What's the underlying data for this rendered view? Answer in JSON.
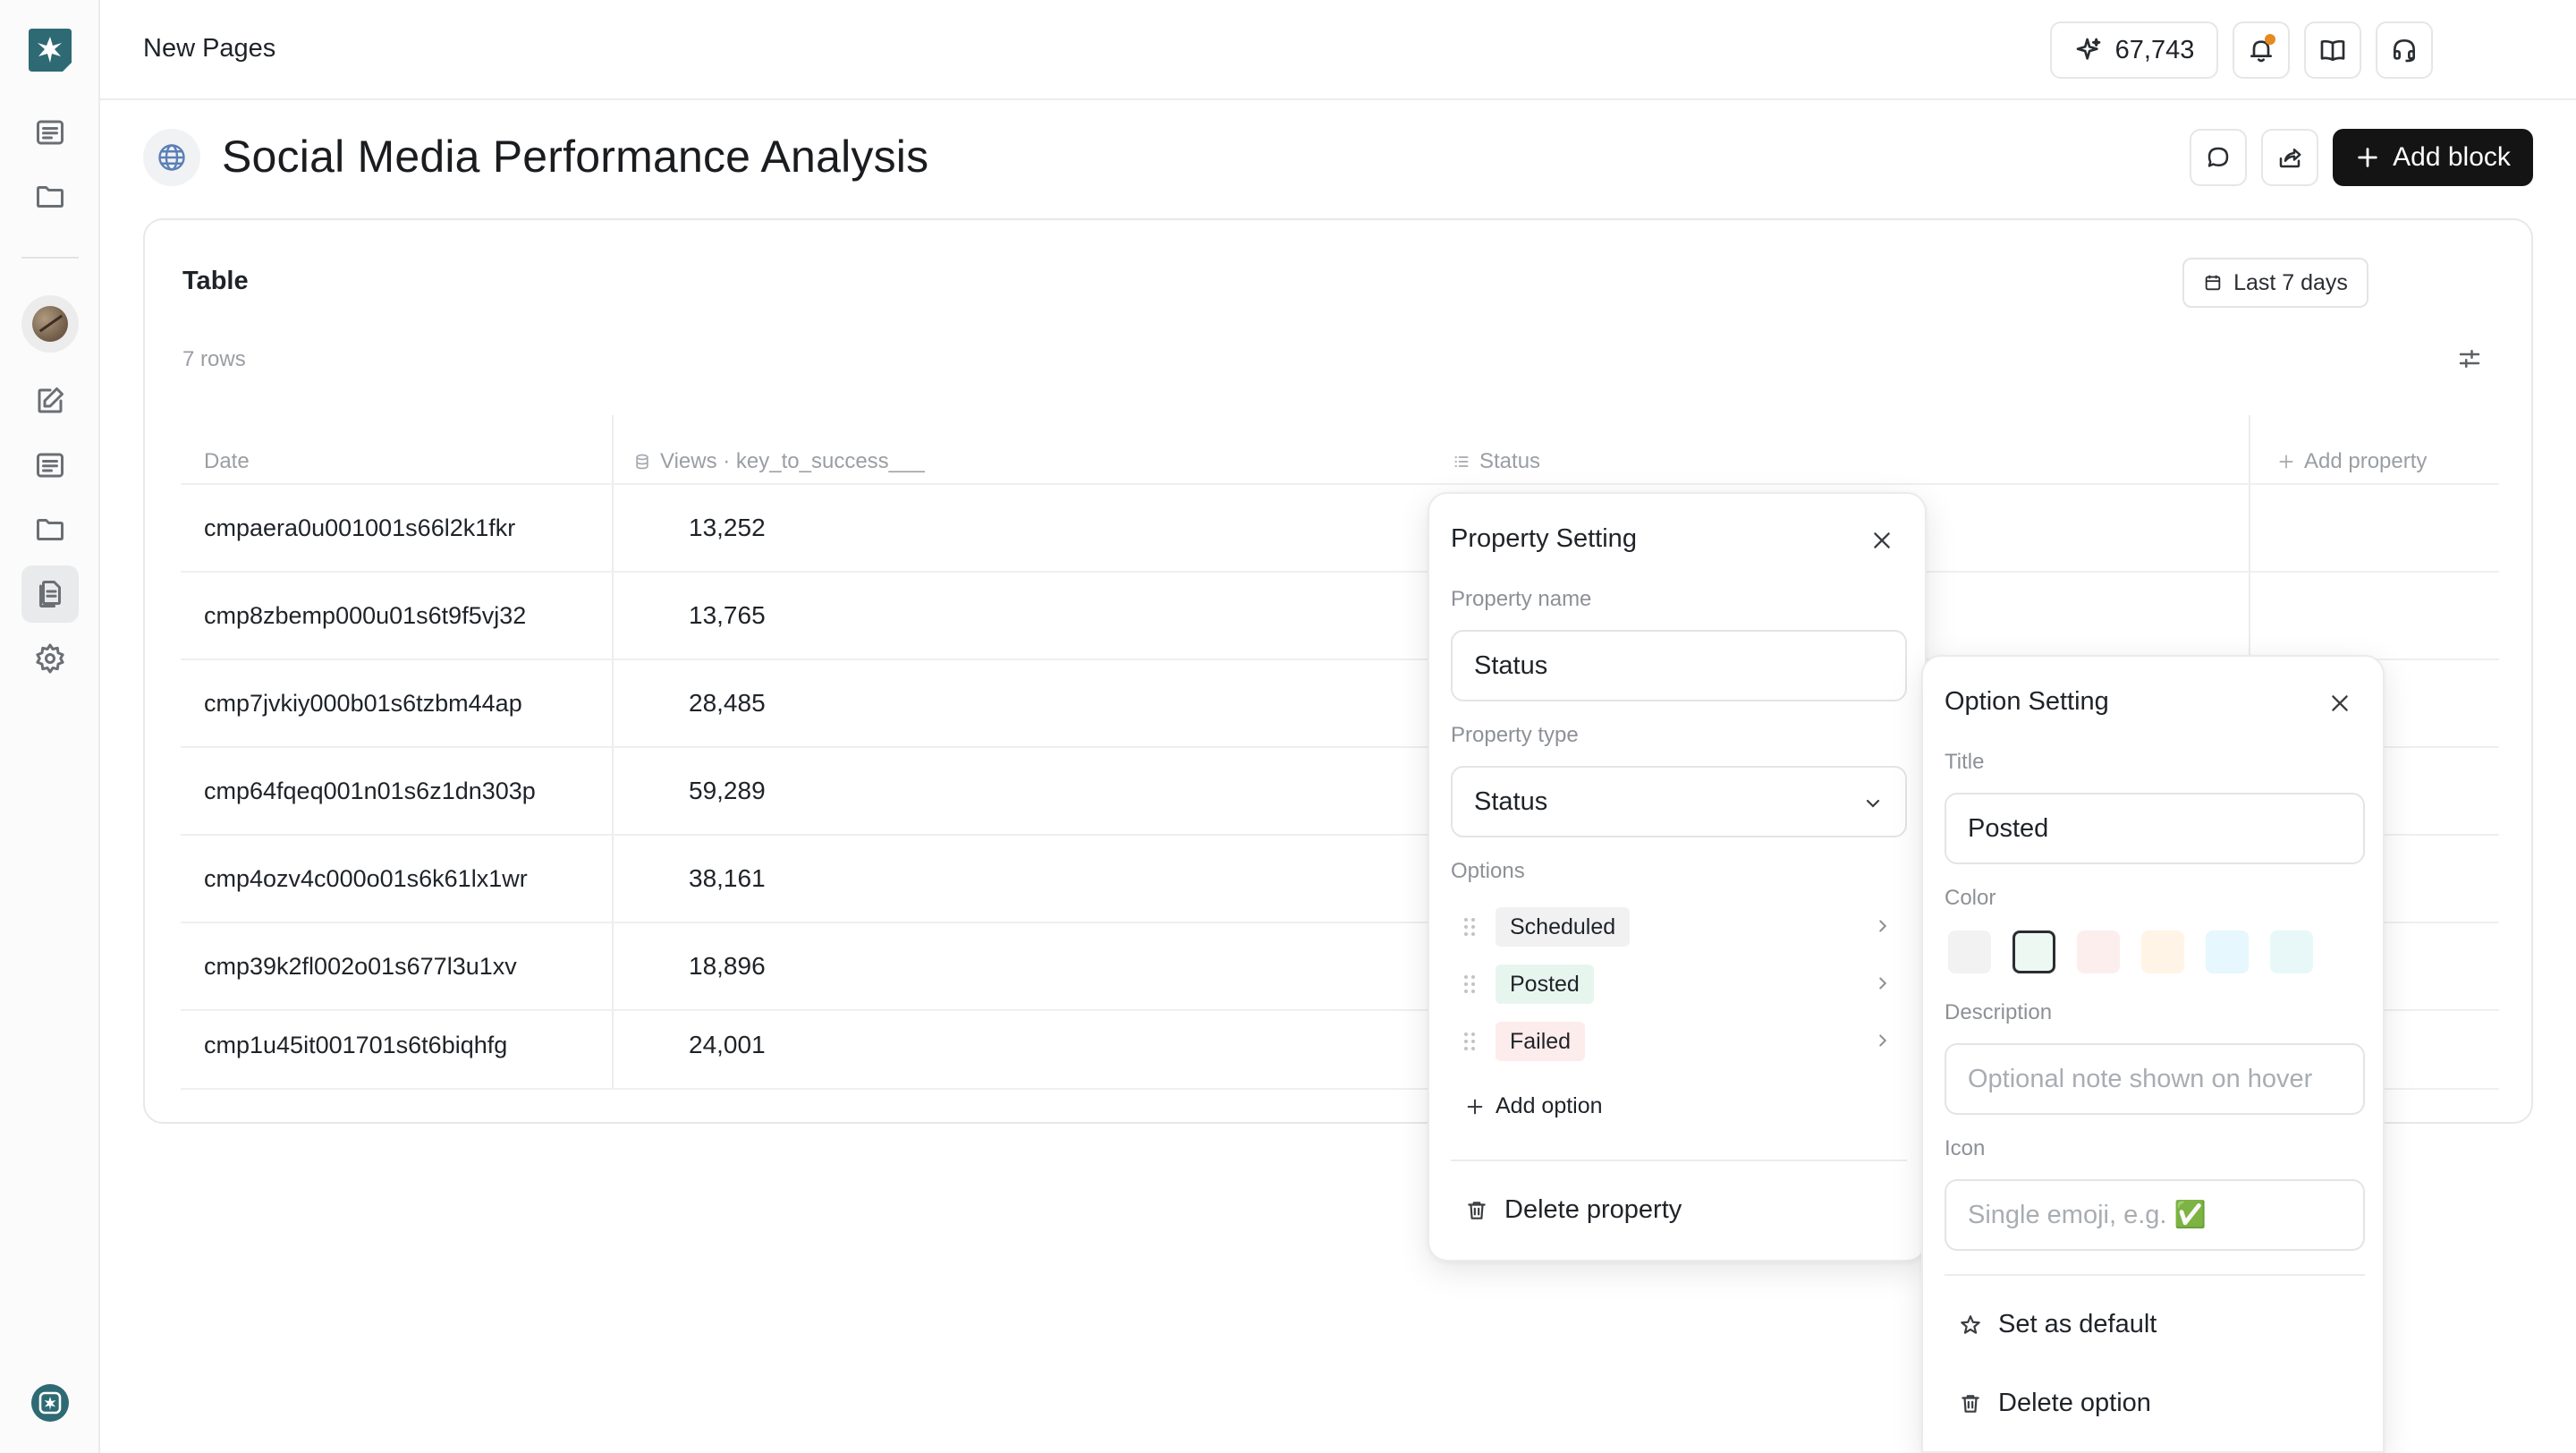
{
  "topbar": {
    "breadcrumb": "New Pages",
    "credits": "67,743"
  },
  "page": {
    "title": "Social Media Performance Analysis",
    "add_block_label": "Add block"
  },
  "table": {
    "title": "Table",
    "date_range": "Last 7 days",
    "row_count": "7 rows",
    "columns": {
      "date": "Date",
      "views": "Views · key_to_success___",
      "status": "Status",
      "add_property": "Add property"
    },
    "rows": [
      {
        "id": "cmpaera0u001001s66l2k1fkr",
        "views": "13,252"
      },
      {
        "id": "cmp8zbemp000u01s6t9f5vj32",
        "views": "13,765"
      },
      {
        "id": "cmp7jvkiy000b01s6tzbm44ap",
        "views": "28,485"
      },
      {
        "id": "cmp64fqeq001n01s6z1dn303p",
        "views": "59,289"
      },
      {
        "id": "cmp4ozv4c000o01s6k61lx1wr",
        "views": "38,161"
      },
      {
        "id": "cmp39k2fl002o01s677l3u1xv",
        "views": "18,896"
      },
      {
        "id": "cmp1u45it001701s6t6biqhfg",
        "views": "24,001"
      }
    ]
  },
  "property_setting": {
    "title": "Property Setting",
    "name_label": "Property name",
    "name_value": "Status",
    "type_label": "Property type",
    "type_value": "Status",
    "options_label": "Options",
    "options": [
      {
        "label": "Scheduled",
        "color": "#f1f1f1"
      },
      {
        "label": "Posted",
        "color": "#e7f5ef"
      },
      {
        "label": "Failed",
        "color": "#fdecec"
      }
    ],
    "add_option_label": "Add option",
    "delete_label": "Delete property"
  },
  "option_setting": {
    "title": "Option Setting",
    "title_label": "Title",
    "title_value": "Posted",
    "color_label": "Color",
    "colors": [
      "#f2f2f2",
      "#eef8f3",
      "#fdeeee",
      "#fff4e6",
      "#e6f7fd",
      "#e8f8f8"
    ],
    "selected_color": "#eef8f3",
    "description_label": "Description",
    "description_placeholder": "Optional note shown on hover",
    "icon_label": "Icon",
    "icon_placeholder": "Single emoji, e.g. ✅",
    "set_default_label": "Set as default",
    "delete_label": "Delete option"
  },
  "colors": {
    "brand": "#2e6a73",
    "primary_button": "#141414",
    "notification_dot": "#e58a1f"
  }
}
